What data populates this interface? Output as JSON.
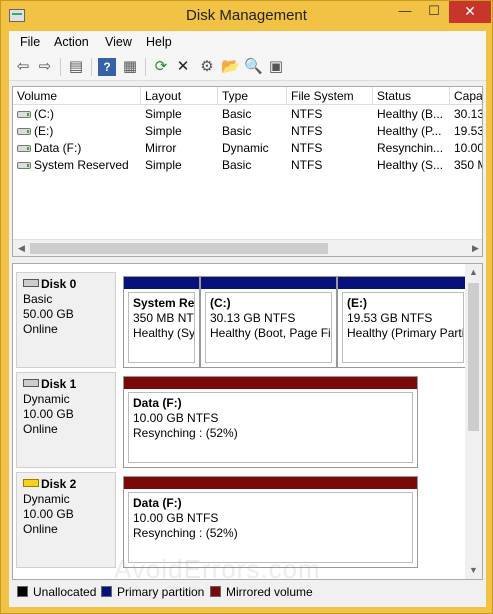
{
  "window": {
    "title": "Disk Management",
    "minimize_glyph": "—",
    "maximize_glyph": "☐",
    "close_glyph": "✕",
    "accent_color": "#f1c244"
  },
  "menu": [
    "File",
    "Action",
    "View",
    "Help"
  ],
  "toolbar": {
    "icons": [
      "back-icon",
      "forward-icon",
      "show-hide-console-tree-icon",
      "help-icon",
      "properties-icon",
      "refresh-icon",
      "delete-icon",
      "settings-icon",
      "open-folder-icon",
      "search-icon",
      "export-icon"
    ],
    "glyphs": {
      "back": "⇦",
      "forward": "⇨",
      "console": "▤",
      "help": "?",
      "props": "▦",
      "refresh": "⟳",
      "delete": "✕",
      "settings": "⚙",
      "open": "📂",
      "search": "🔍",
      "export": "▣"
    }
  },
  "volume_list": {
    "columns": [
      "Volume",
      "Layout",
      "Type",
      "File System",
      "Status",
      "Capa"
    ],
    "rows": [
      {
        "volume": "(C:)",
        "layout": "Simple",
        "type": "Basic",
        "fs": "NTFS",
        "status": "Healthy (B...",
        "capacity": "30.13"
      },
      {
        "volume": "(E:)",
        "layout": "Simple",
        "type": "Basic",
        "fs": "NTFS",
        "status": "Healthy (P...",
        "capacity": "19.53"
      },
      {
        "volume": "Data (F:)",
        "layout": "Mirror",
        "type": "Dynamic",
        "fs": "NTFS",
        "status": "Resynchin...",
        "capacity": "10.00"
      },
      {
        "volume": "System Reserved",
        "layout": "Simple",
        "type": "Basic",
        "fs": "NTFS",
        "status": "Healthy (S...",
        "capacity": "350 M"
      }
    ]
  },
  "disks": [
    {
      "name": "Disk 0",
      "kind": "Basic",
      "size": "50.00 GB",
      "state": "Online",
      "partitions": [
        {
          "name": "System Res",
          "line1": "350 MB NTF",
          "line2": "Healthy (Sy"
        },
        {
          "name": "(C:)",
          "line1": "30.13 GB NTFS",
          "line2": "Healthy (Boot, Page Fil"
        },
        {
          "name": "(E:)",
          "line1": "19.53 GB NTFS",
          "line2": "Healthy (Primary Parti"
        }
      ]
    },
    {
      "name": "Disk 1",
      "kind": "Dynamic",
      "size": "10.00 GB",
      "state": "Online",
      "partitions": [
        {
          "name": "Data  (F:)",
          "line1": "10.00 GB NTFS",
          "line2": "Resynching : (52%)"
        }
      ]
    },
    {
      "name": "Disk 2",
      "kind": "Dynamic",
      "size": "10.00 GB",
      "state": "Online",
      "partitions": [
        {
          "name": "Data  (F:)",
          "line1": "10.00 GB NTFS",
          "line2": "Resynching : (52%)"
        }
      ]
    }
  ],
  "legend": [
    {
      "label": "Unallocated",
      "color": "#000000"
    },
    {
      "label": "Primary partition",
      "color": "#08107a"
    },
    {
      "label": "Mirrored volume",
      "color": "#7a0a0a"
    }
  ],
  "watermark": "AvoidErrors.com"
}
